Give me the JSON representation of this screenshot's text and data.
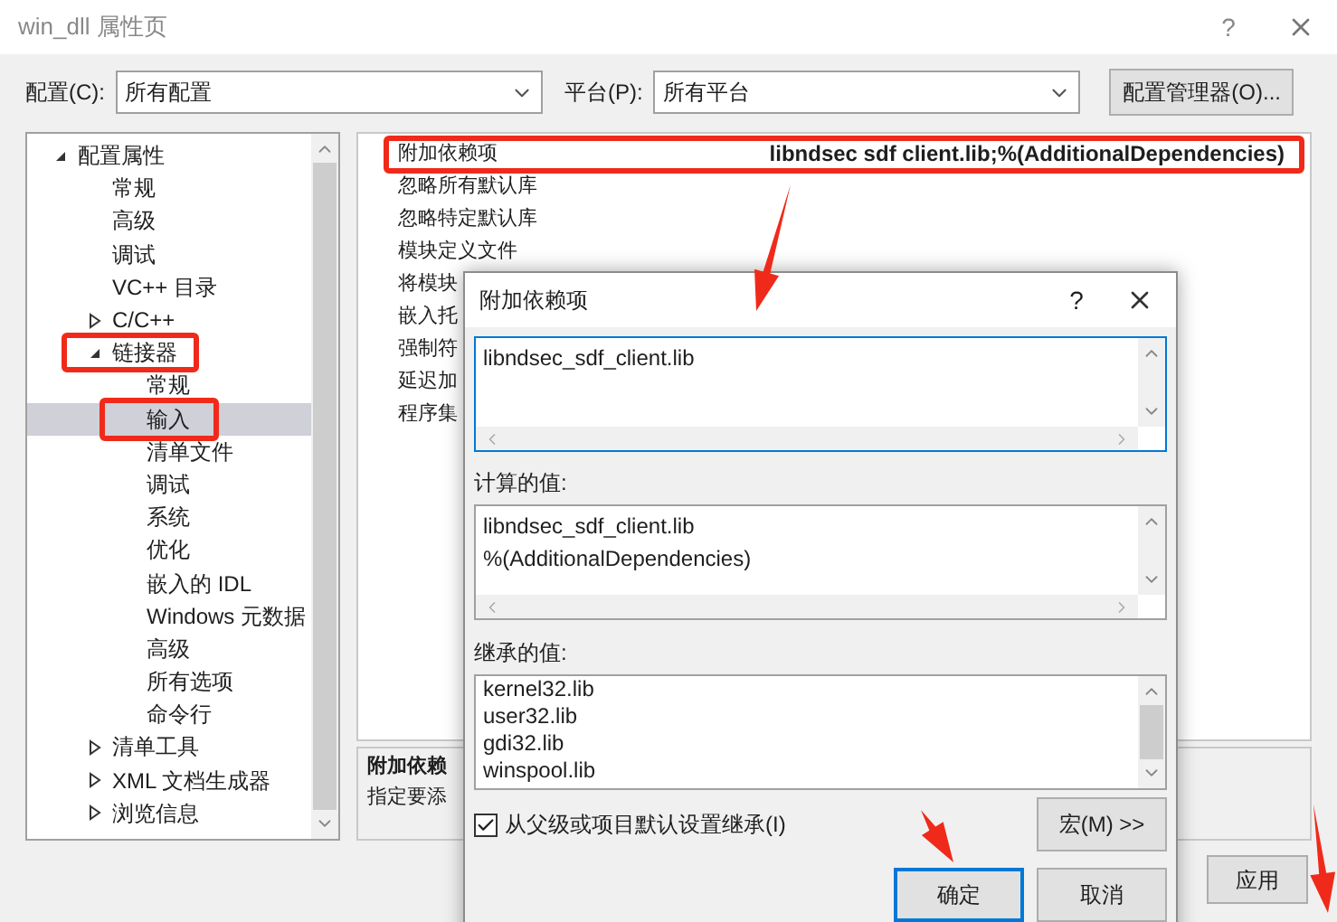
{
  "window": {
    "title": "win_dll 属性页",
    "help": "?"
  },
  "config_bar": {
    "config_label": "配置(C):",
    "config_value": "所有配置",
    "platform_label": "平台(P):",
    "platform_value": "所有平台",
    "manager_button": "配置管理器(O)..."
  },
  "tree": [
    {
      "label": "配置属性",
      "expanded": true,
      "selected": false,
      "children": [
        {
          "label": "常规",
          "selected": false
        },
        {
          "label": "高级",
          "selected": false
        },
        {
          "label": "调试",
          "selected": false
        },
        {
          "label": "VC++ 目录",
          "selected": false
        },
        {
          "label": "C/C++",
          "expanded": false,
          "selected": false
        },
        {
          "label": "链接器",
          "expanded": true,
          "selected": false,
          "children": [
            {
              "label": "常规",
              "selected": false
            },
            {
              "label": "输入",
              "selected": true
            },
            {
              "label": "清单文件",
              "selected": false
            },
            {
              "label": "调试",
              "selected": false
            },
            {
              "label": "系统",
              "selected": false
            },
            {
              "label": "优化",
              "selected": false
            },
            {
              "label": "嵌入的 IDL",
              "selected": false
            },
            {
              "label": "Windows 元数据",
              "selected": false
            },
            {
              "label": "高级",
              "selected": false
            },
            {
              "label": "所有选项",
              "selected": false
            },
            {
              "label": "命令行",
              "selected": false
            }
          ]
        },
        {
          "label": "清单工具",
          "expanded": false,
          "selected": false
        },
        {
          "label": "XML 文档生成器",
          "expanded": false,
          "selected": false
        },
        {
          "label": "浏览信息",
          "expanded": false,
          "selected": false
        }
      ]
    }
  ],
  "properties": [
    {
      "name": "附加依赖项",
      "value": "libndsec sdf client.lib;%(AdditionalDependencies)"
    },
    {
      "name": "忽略所有默认库"
    },
    {
      "name": "忽略特定默认库"
    },
    {
      "name": "模块定义文件"
    },
    {
      "name": "将模块"
    },
    {
      "name": "嵌入托"
    },
    {
      "name": "强制符"
    },
    {
      "name": "延迟加"
    },
    {
      "name": "程序集"
    }
  ],
  "description": {
    "title": "附加依赖",
    "text": "指定要添"
  },
  "apply_button": "应用",
  "dialog": {
    "title": "附加依赖项",
    "help": "?",
    "edit_lines": [
      "libndsec_sdf_client.lib"
    ],
    "computed_label": "计算的值:",
    "computed_lines": [
      "libndsec_sdf_client.lib",
      "%(AdditionalDependencies)"
    ],
    "inherited_label": "继承的值:",
    "inherited_lines": [
      "kernel32.lib",
      "user32.lib",
      "gdi32.lib",
      "winspool.lib"
    ],
    "inherit_checkbox": {
      "label": "从父级或项目默认设置继承(I)",
      "checked": true
    },
    "macro_button": "宏(M) >>",
    "ok_button": "确定",
    "cancel_button": "取消"
  }
}
